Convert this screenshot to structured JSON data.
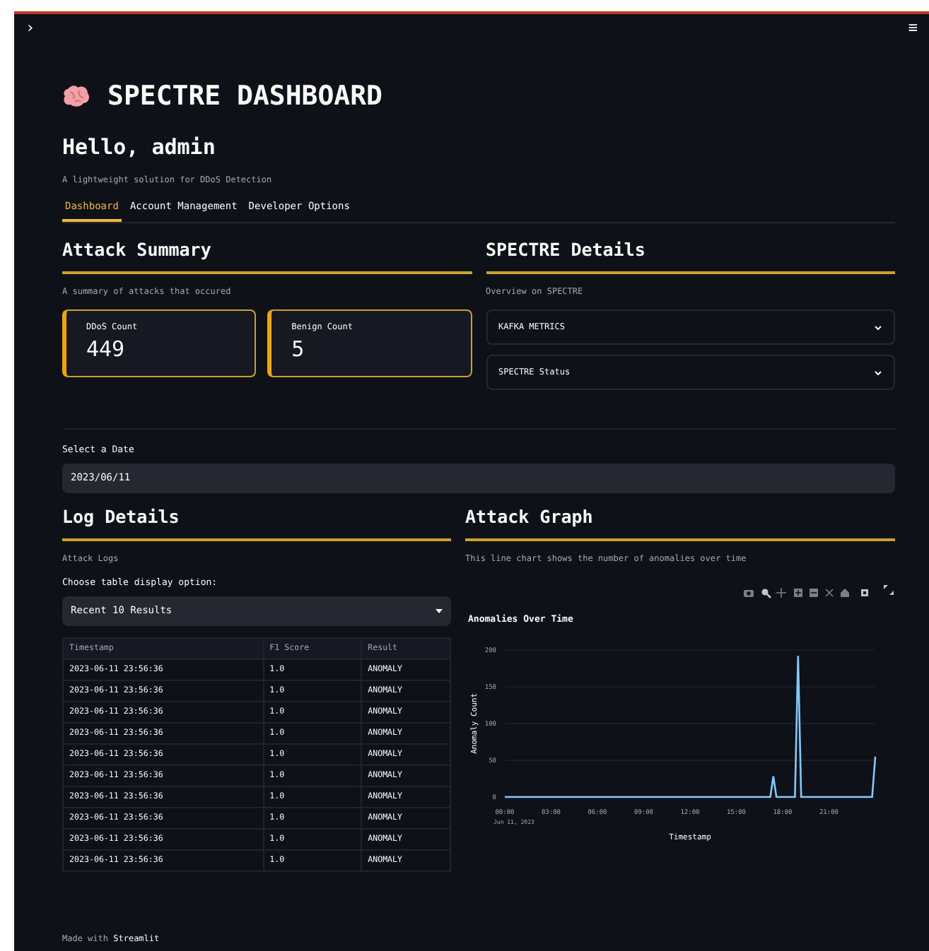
{
  "header": {
    "sidebar_toggle": "›",
    "menu": "≡"
  },
  "title": "SPECTRE DASHBOARD",
  "greeting": "Hello, admin",
  "subtitle": "A lightweight solution for DDoS Detection",
  "tabs": [
    {
      "label": "Dashboard",
      "selected": true
    },
    {
      "label": "Account Management",
      "selected": false
    },
    {
      "label": "Developer Options",
      "selected": false
    }
  ],
  "attack_summary": {
    "heading": "Attack Summary",
    "caption": "A summary of attacks that occured",
    "metrics": [
      {
        "label": "DDoS Count",
        "value": "449"
      },
      {
        "label": "Benign Count",
        "value": "5"
      }
    ]
  },
  "spectre_details": {
    "heading": "SPECTRE Details",
    "caption": "Overview on SPECTRE",
    "expanders": [
      {
        "label": "KAFKA METRICS",
        "expanded": false
      },
      {
        "label": "SPECTRE Status",
        "expanded": false
      }
    ]
  },
  "date_input": {
    "label": "Select a Date",
    "value": "2023/06/11"
  },
  "log_details": {
    "heading": "Log Details",
    "caption": "Attack Logs",
    "select_label": "Choose table display option:",
    "select_value": "Recent 10 Results",
    "table": {
      "columns": [
        "Timestamp",
        "F1 Score",
        "Result"
      ],
      "rows": [
        [
          "2023-06-11 23:56:36",
          "1.0",
          "ANOMALY"
        ],
        [
          "2023-06-11 23:56:36",
          "1.0",
          "ANOMALY"
        ],
        [
          "2023-06-11 23:56:36",
          "1.0",
          "ANOMALY"
        ],
        [
          "2023-06-11 23:56:36",
          "1.0",
          "ANOMALY"
        ],
        [
          "2023-06-11 23:56:36",
          "1.0",
          "ANOMALY"
        ],
        [
          "2023-06-11 23:56:36",
          "1.0",
          "ANOMALY"
        ],
        [
          "2023-06-11 23:56:36",
          "1.0",
          "ANOMALY"
        ],
        [
          "2023-06-11 23:56:36",
          "1.0",
          "ANOMALY"
        ],
        [
          "2023-06-11 23:56:36",
          "1.0",
          "ANOMALY"
        ],
        [
          "2023-06-11 23:56:36",
          "1.0",
          "ANOMALY"
        ]
      ]
    }
  },
  "attack_graph": {
    "heading": "Attack Graph",
    "caption": "This line chart shows the number of anomalies over time",
    "chart_data": {
      "type": "line",
      "title": "Anomalies Over Time",
      "xlabel": "Timestamp",
      "ylabel": "Anomaly Count",
      "x": [
        0,
        17.2,
        17.4,
        17.6,
        18.8,
        19.0,
        19.2,
        23.8,
        24
      ],
      "series": [
        {
          "color": "#83c9ff",
          "values": [
            0,
            0,
            28,
            0,
            0,
            192,
            0,
            0,
            55
          ]
        }
      ],
      "xlim": [
        0,
        24
      ],
      "ylim": [
        0,
        200
      ],
      "grid": true,
      "xticks": [
        {
          "value": 0,
          "label": "00:00"
        },
        {
          "value": 3,
          "label": "03:00"
        },
        {
          "value": 6,
          "label": "06:00"
        },
        {
          "value": 9,
          "label": "09:00"
        },
        {
          "value": 12,
          "label": "12:00"
        },
        {
          "value": 15,
          "label": "15:00"
        },
        {
          "value": 18,
          "label": "18:00"
        },
        {
          "value": 21,
          "label": "21:00"
        }
      ],
      "yticks": [
        0,
        50,
        100,
        150,
        200
      ],
      "annotations": [
        "Jun 11, 2023"
      ]
    }
  },
  "footer": {
    "prefix": "Made with",
    "link": "Streamlit"
  }
}
